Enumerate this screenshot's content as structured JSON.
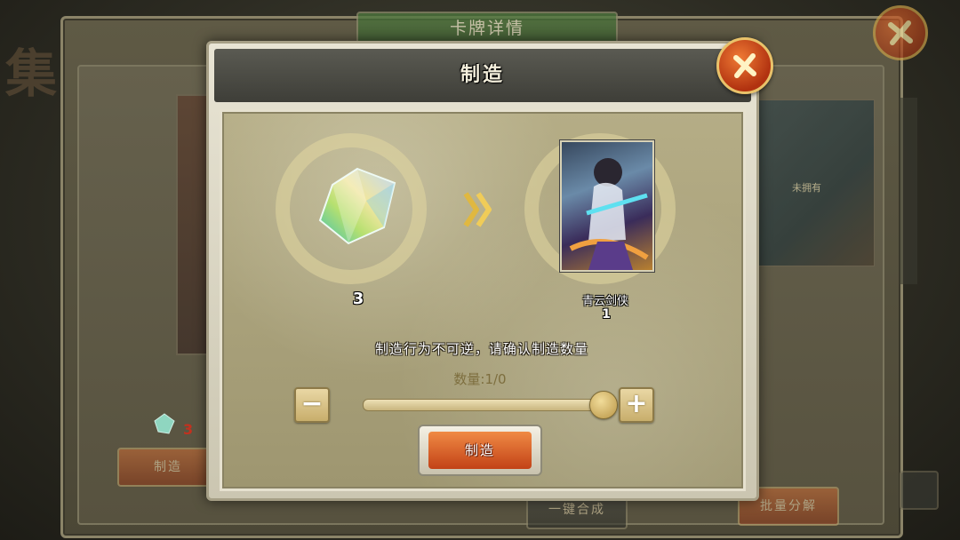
{
  "background": {
    "side_glyph": "集",
    "window_title": "卡牌详情",
    "unowned_label": "未拥有",
    "crystal_count": "3",
    "make_button": "制造",
    "merge_button": "一键合成",
    "decompose_button": "批量分解"
  },
  "dialog": {
    "title": "制造",
    "material": {
      "icon": "crystal-icon",
      "count": "3"
    },
    "result": {
      "card_name": "青云剑侠",
      "count": "1"
    },
    "warning": "制造行为不可逆，请确认制造数量",
    "quantity": {
      "text": "数量:1/0",
      "slider_fraction": 1.0
    },
    "buttons": {
      "minus": "−",
      "plus": "+",
      "make": "制造"
    },
    "icons": {
      "close": "close-icon",
      "arrow": "double-chevron-right-icon"
    }
  },
  "colors": {
    "accent_orange": "#e3692c",
    "gold": "#e9c26a"
  }
}
